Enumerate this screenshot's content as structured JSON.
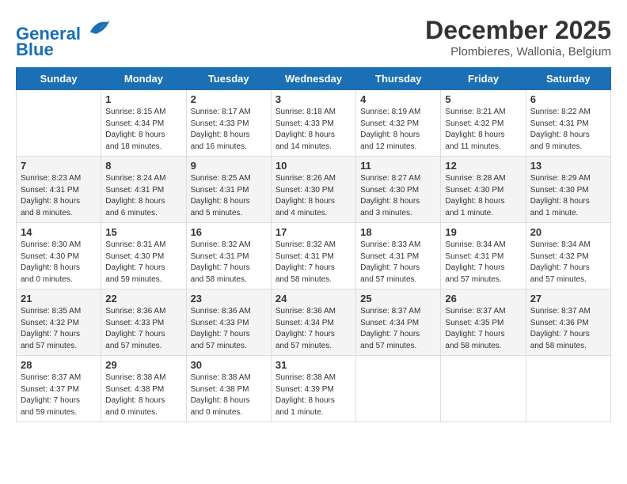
{
  "header": {
    "logo_line1": "General",
    "logo_line2": "Blue",
    "month_title": "December 2025",
    "subtitle": "Plombieres, Wallonia, Belgium"
  },
  "days_of_week": [
    "Sunday",
    "Monday",
    "Tuesday",
    "Wednesday",
    "Thursday",
    "Friday",
    "Saturday"
  ],
  "weeks": [
    [
      {
        "day": "",
        "info": ""
      },
      {
        "day": "1",
        "info": "Sunrise: 8:15 AM\nSunset: 4:34 PM\nDaylight: 8 hours\nand 18 minutes."
      },
      {
        "day": "2",
        "info": "Sunrise: 8:17 AM\nSunset: 4:33 PM\nDaylight: 8 hours\nand 16 minutes."
      },
      {
        "day": "3",
        "info": "Sunrise: 8:18 AM\nSunset: 4:33 PM\nDaylight: 8 hours\nand 14 minutes."
      },
      {
        "day": "4",
        "info": "Sunrise: 8:19 AM\nSunset: 4:32 PM\nDaylight: 8 hours\nand 12 minutes."
      },
      {
        "day": "5",
        "info": "Sunrise: 8:21 AM\nSunset: 4:32 PM\nDaylight: 8 hours\nand 11 minutes."
      },
      {
        "day": "6",
        "info": "Sunrise: 8:22 AM\nSunset: 4:31 PM\nDaylight: 8 hours\nand 9 minutes."
      }
    ],
    [
      {
        "day": "7",
        "info": "Sunrise: 8:23 AM\nSunset: 4:31 PM\nDaylight: 8 hours\nand 8 minutes."
      },
      {
        "day": "8",
        "info": "Sunrise: 8:24 AM\nSunset: 4:31 PM\nDaylight: 8 hours\nand 6 minutes."
      },
      {
        "day": "9",
        "info": "Sunrise: 8:25 AM\nSunset: 4:31 PM\nDaylight: 8 hours\nand 5 minutes."
      },
      {
        "day": "10",
        "info": "Sunrise: 8:26 AM\nSunset: 4:30 PM\nDaylight: 8 hours\nand 4 minutes."
      },
      {
        "day": "11",
        "info": "Sunrise: 8:27 AM\nSunset: 4:30 PM\nDaylight: 8 hours\nand 3 minutes."
      },
      {
        "day": "12",
        "info": "Sunrise: 8:28 AM\nSunset: 4:30 PM\nDaylight: 8 hours\nand 1 minute."
      },
      {
        "day": "13",
        "info": "Sunrise: 8:29 AM\nSunset: 4:30 PM\nDaylight: 8 hours\nand 1 minute."
      }
    ],
    [
      {
        "day": "14",
        "info": "Sunrise: 8:30 AM\nSunset: 4:30 PM\nDaylight: 8 hours\nand 0 minutes."
      },
      {
        "day": "15",
        "info": "Sunrise: 8:31 AM\nSunset: 4:30 PM\nDaylight: 7 hours\nand 59 minutes."
      },
      {
        "day": "16",
        "info": "Sunrise: 8:32 AM\nSunset: 4:31 PM\nDaylight: 7 hours\nand 58 minutes."
      },
      {
        "day": "17",
        "info": "Sunrise: 8:32 AM\nSunset: 4:31 PM\nDaylight: 7 hours\nand 58 minutes."
      },
      {
        "day": "18",
        "info": "Sunrise: 8:33 AM\nSunset: 4:31 PM\nDaylight: 7 hours\nand 57 minutes."
      },
      {
        "day": "19",
        "info": "Sunrise: 8:34 AM\nSunset: 4:31 PM\nDaylight: 7 hours\nand 57 minutes."
      },
      {
        "day": "20",
        "info": "Sunrise: 8:34 AM\nSunset: 4:32 PM\nDaylight: 7 hours\nand 57 minutes."
      }
    ],
    [
      {
        "day": "21",
        "info": "Sunrise: 8:35 AM\nSunset: 4:32 PM\nDaylight: 7 hours\nand 57 minutes."
      },
      {
        "day": "22",
        "info": "Sunrise: 8:36 AM\nSunset: 4:33 PM\nDaylight: 7 hours\nand 57 minutes."
      },
      {
        "day": "23",
        "info": "Sunrise: 8:36 AM\nSunset: 4:33 PM\nDaylight: 7 hours\nand 57 minutes."
      },
      {
        "day": "24",
        "info": "Sunrise: 8:36 AM\nSunset: 4:34 PM\nDaylight: 7 hours\nand 57 minutes."
      },
      {
        "day": "25",
        "info": "Sunrise: 8:37 AM\nSunset: 4:34 PM\nDaylight: 7 hours\nand 57 minutes."
      },
      {
        "day": "26",
        "info": "Sunrise: 8:37 AM\nSunset: 4:35 PM\nDaylight: 7 hours\nand 58 minutes."
      },
      {
        "day": "27",
        "info": "Sunrise: 8:37 AM\nSunset: 4:36 PM\nDaylight: 7 hours\nand 58 minutes."
      }
    ],
    [
      {
        "day": "28",
        "info": "Sunrise: 8:37 AM\nSunset: 4:37 PM\nDaylight: 7 hours\nand 59 minutes."
      },
      {
        "day": "29",
        "info": "Sunrise: 8:38 AM\nSunset: 4:38 PM\nDaylight: 8 hours\nand 0 minutes."
      },
      {
        "day": "30",
        "info": "Sunrise: 8:38 AM\nSunset: 4:38 PM\nDaylight: 8 hours\nand 0 minutes."
      },
      {
        "day": "31",
        "info": "Sunrise: 8:38 AM\nSunset: 4:39 PM\nDaylight: 8 hours\nand 1 minute."
      },
      {
        "day": "",
        "info": ""
      },
      {
        "day": "",
        "info": ""
      },
      {
        "day": "",
        "info": ""
      }
    ]
  ]
}
